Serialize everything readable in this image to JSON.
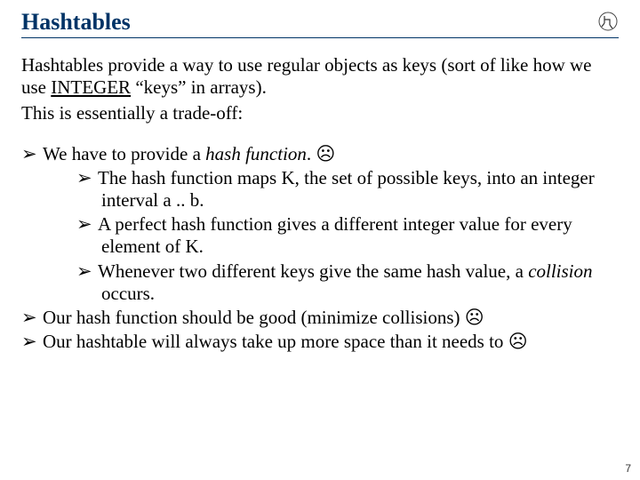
{
  "title": "Hashtables",
  "intro_before": "Hashtables provide a way to use regular objects as keys (sort of like how we use ",
  "intro_underlined": "INTEGER",
  "intro_after": " “keys” in arrays).",
  "intro2": "This is essentially a trade-off:",
  "b1_before": "We have to provide a ",
  "b1_italic": "hash function",
  "b1_after": ". ",
  "b1a": "The hash function maps K, the set of possible keys, into an integer interval a .. b.",
  "b1b": "A perfect hash function gives a different integer value for every element of K.",
  "b1c_before": "Whenever two different keys give the same hash value, a ",
  "b1c_italic": "collision",
  "b1c_after": " occurs.",
  "b2": "Our hash function should be good (minimize collisions) ",
  "b3": "Our hashtable will always take up more space than it needs to ",
  "sad": "☹",
  "arrow": "➢",
  "page": "7"
}
